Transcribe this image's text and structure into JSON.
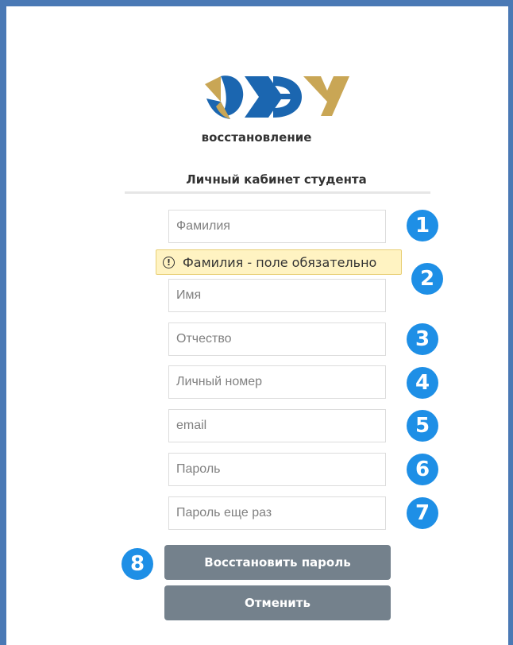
{
  "header": {
    "subtitle": "восстановление",
    "section_title": "Личный кабинет студента"
  },
  "fields": [
    {
      "placeholder": "Фамилия",
      "badge": "1"
    },
    {
      "placeholder": "Имя",
      "badge": "2"
    },
    {
      "placeholder": "Отчество",
      "badge": "3"
    },
    {
      "placeholder": "Личный номер",
      "badge": "4"
    },
    {
      "placeholder": "email",
      "badge": "5"
    },
    {
      "placeholder": "Пароль",
      "badge": "6"
    },
    {
      "placeholder": "Пароль еще раз",
      "badge": "7"
    }
  ],
  "validation": {
    "message": "Фамилия - поле обязательно",
    "icon": "warning-circle-icon",
    "icon_glyph": "!"
  },
  "buttons": {
    "restore_label": "Восстановить пароль",
    "restore_badge": "8",
    "cancel_label": "Отменить"
  },
  "colors": {
    "frame": "#4a79b5",
    "badge": "#1e8fe6",
    "button": "#74818c",
    "tooltip_bg": "#fff3c2",
    "logo_blue": "#1b66b0",
    "logo_gold": "#c9a655"
  }
}
